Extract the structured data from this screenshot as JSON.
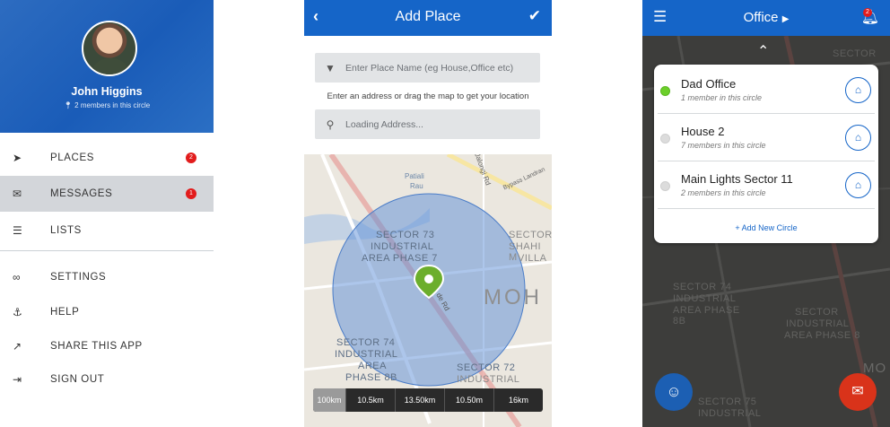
{
  "drawer": {
    "user_name": "John Higgins",
    "user_members": "2 members in this circle",
    "menu": [
      {
        "label": "PLACES",
        "icon": "navigation-arrow-icon",
        "badge": "2"
      },
      {
        "label": "MESSAGES",
        "icon": "envelope-icon",
        "badge": "1",
        "active": true
      },
      {
        "label": "LISTS",
        "icon": "list-icon"
      },
      {
        "label": "SETTINGS",
        "icon": "link-icon"
      },
      {
        "label": "HELP",
        "icon": "anchor-icon"
      },
      {
        "label": "SHARE THIS APP",
        "icon": "share-icon"
      },
      {
        "label": "SIGN OUT",
        "icon": "sign-out-icon"
      }
    ]
  },
  "add_place": {
    "title": "Add Place",
    "name_placeholder": "Enter Place Name (eg House,Office etc)",
    "hint": "Enter an address or drag the map to get your location",
    "address_value": "Loading Address...",
    "map_labels": {
      "road1": "Jalongi Rd",
      "road2": "Bypass Landran",
      "patiali": "Patiali",
      "rau": "Rau",
      "sector73": "SECTOR 73",
      "industrial_73": "INDUSTRIAL",
      "area_phase_7": "AREA PHASE 7",
      "sector_shahi": "SECTOR",
      "shahi": "SHAHI M",
      "villa": "VILLA",
      "moh": "MOH",
      "sector74": "SECTOR 74",
      "industrial_74": "INDUSTRIAL",
      "area_74": "AREA",
      "phase_8b": "PHASE 8B",
      "sector72": "SECTOR 72",
      "industrial_72": "INDUSTRIAL",
      "road_de": "de Rd"
    },
    "radius_options": [
      "100km",
      "10.5km",
      "13.50km",
      "10.50m",
      "16km"
    ],
    "selected_radius": "100km"
  },
  "circles": {
    "title": "Office",
    "bell_count": "2",
    "list": [
      {
        "name": "Dad Office",
        "members": "1 member in this circle",
        "active": true
      },
      {
        "name": "House 2",
        "members": "7 members in this circle",
        "active": false
      },
      {
        "name": "Main Lights Sector 11",
        "members": "2 members in this circle",
        "active": false
      }
    ],
    "add_label": "Add New Circle",
    "map_labels": {
      "sector_top": "SECTOR",
      "sector74": "SECTOR 74",
      "industrial": "INDUSTRIAL",
      "area_phase_8b": "AREA PHASE 8B",
      "sector": "SECTOR",
      "industrial2": "INDUSTRIAL",
      "area_phase_8": "AREA PHASE 8",
      "mo": "MO",
      "sector75": "SECTOR 75",
      "industrial3": "INDUSTRIAL"
    }
  }
}
